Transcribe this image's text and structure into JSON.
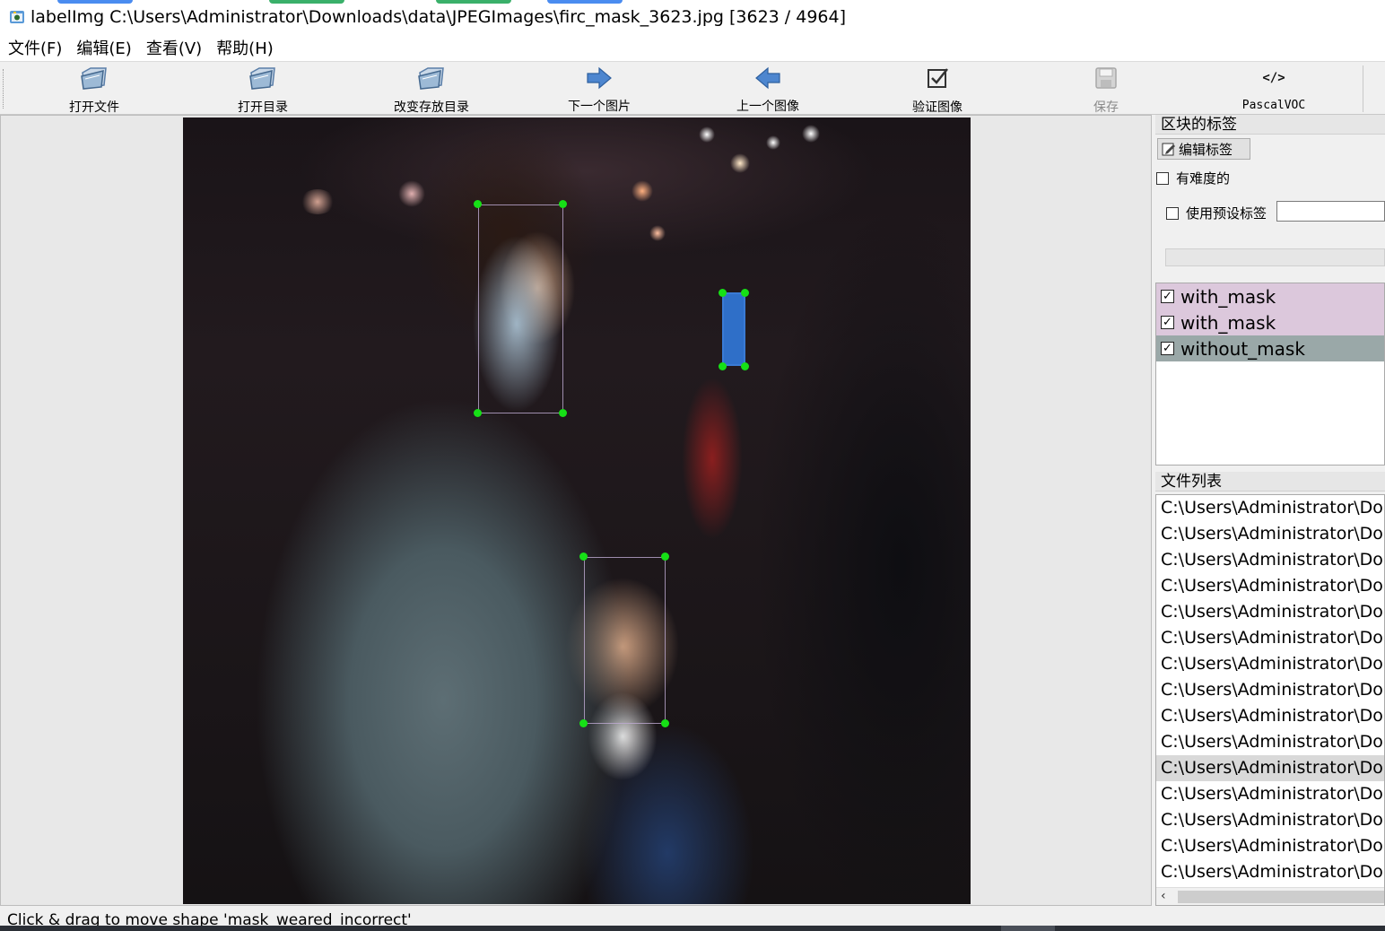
{
  "window": {
    "title": "labelImg C:\\Users\\Administrator\\Downloads\\data\\JPEGImages\\firc_mask_3623.jpg [3623 / 4964]"
  },
  "menu": [
    "文件(F)",
    "编辑(E)",
    "查看(V)",
    "帮助(H)"
  ],
  "toolbar": {
    "open_file": "打开文件",
    "open_dir": "打开目录",
    "change_save_dir": "改变存放目录",
    "next_image": "下一个图片",
    "prev_image": "上一个图像",
    "verify_image": "验证图像",
    "save": "保存",
    "format": "PascalVOC",
    "save_enabled": false,
    "format_icon": "</>"
  },
  "dock": {
    "box_labels_title": "区块的标签",
    "edit_label_button": "编辑标签",
    "difficult_label": "有难度的",
    "difficult_checked": false,
    "use_default_label": "使用预设标签",
    "use_default_checked": false,
    "default_label_value": "",
    "labels": [
      {
        "name": "with_mask",
        "checked": true,
        "color": "#dcc8dc"
      },
      {
        "name": "with_mask",
        "checked": true,
        "color": "#dcc8dc"
      },
      {
        "name": "without_mask",
        "checked": true,
        "color": "#9aa8a8"
      }
    ],
    "file_list_title": "文件列表",
    "files": [
      "C:\\Users\\Administrator\\Do",
      "C:\\Users\\Administrator\\Do",
      "C:\\Users\\Administrator\\Do",
      "C:\\Users\\Administrator\\Do",
      "C:\\Users\\Administrator\\Do",
      "C:\\Users\\Administrator\\Do",
      "C:\\Users\\Administrator\\Do",
      "C:\\Users\\Administrator\\Do",
      "C:\\Users\\Administrator\\Do",
      "C:\\Users\\Administrator\\Do",
      "C:\\Users\\Administrator\\Do",
      "C:\\Users\\Administrator\\Do",
      "C:\\Users\\Administrator\\Do",
      "C:\\Users\\Administrator\\Do",
      "C:\\Users\\Administrator\\Do"
    ],
    "current_file_index": 10
  },
  "status": {
    "text": "Click & drag to move shape 'mask_weared_incorrect'"
  },
  "colors": {
    "handle": "#16e016",
    "selected_box": "#2f6fc8",
    "accent_blue": "#3a7bd5"
  }
}
